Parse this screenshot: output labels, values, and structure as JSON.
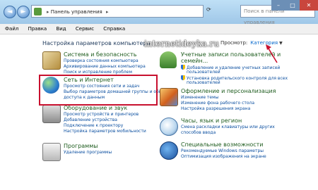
{
  "window": {
    "breadcrumb": "Панель управления",
    "search_placeholder": "Поиск в панели управления",
    "back_label": "◄",
    "forward_label": "►",
    "minimize": "–",
    "maximize": "□",
    "close": "✕"
  },
  "menu": [
    "Файл",
    "Правка",
    "Вид",
    "Сервис",
    "Справка"
  ],
  "main": {
    "heading": "Настройка параметров компьютера",
    "view_label": "Просмотр:",
    "view_value": "Категория",
    "watermark": "internetideyka.ru"
  },
  "left_groups": [
    {
      "title": "Система и безопасность",
      "links": [
        "Проверка состояния компьютера",
        "Архивирование данных компьютера",
        "Поиск и исправление проблем"
      ]
    },
    {
      "title": "Сеть и Интернет",
      "links": [
        "Просмотр состояния сети и задач",
        "Выбор параметров домашней группы и общего",
        "доступа к данным"
      ]
    },
    {
      "title": "Оборудование и звук",
      "links": [
        "Просмотр устройств и принтеров",
        "Добавление устройства",
        "Подключение к проектору",
        "Настройка параметров мобильности"
      ]
    },
    {
      "title": "Программы",
      "links": [
        "Удаление программы"
      ]
    }
  ],
  "right_groups": [
    {
      "title": "Учетные записи пользователей и",
      "title2": "семейн...",
      "links": [
        "Добавление и удаление учетных записей",
        "пользователей",
        "Установка родительского контроля для всех",
        "пользователей"
      ]
    },
    {
      "title": "Оформление и персонализация",
      "links": [
        "Изменение темы",
        "Изменение фона рабочего стола",
        "Настройка разрешения экрана"
      ]
    },
    {
      "title": "Часы, язык и регион",
      "links": [
        "Смена раскладки клавиатуры или других",
        "способов ввода"
      ]
    },
    {
      "title": "Специальные возможности",
      "links": [
        "Рекомендуемые Windows параметры",
        "Оптимизация изображения на экране"
      ]
    }
  ],
  "colors": {
    "highlight": "#c8102e",
    "link": "#0b4fa0",
    "group_title": "#1e5c1e"
  }
}
